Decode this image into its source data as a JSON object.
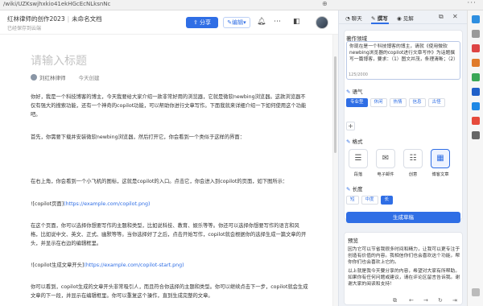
{
  "browser": {
    "url": "/wiki/UZKswjhxkio41ekHGcEcNLksnNc",
    "zoom_icon": "zoom-icon",
    "menu_icon": "more-dots-icon"
  },
  "header": {
    "breadcrumb_space": "红林律师的创作2023",
    "breadcrumb_doc": "未命名文档",
    "saved_status": "已经保存到云端",
    "share_label": "分享",
    "edit_label": "编辑",
    "share_icon": "share-icon",
    "edit_icon": "pencil-icon",
    "icons": [
      "bell-icon",
      "more-icon",
      "avatar"
    ]
  },
  "document": {
    "title_placeholder": "请输入标题",
    "author": "刘红林律师",
    "created": "今天创建",
    "paragraphs": [
      "你好，我是一个科技博客的博主，今天我要给大家介绍一款非常好用的浏览器，它就是微软newbing浏览器。这款浏览器不仅有强大的搜索功能，还有一个神奇的copilot功能，可以帮助你进行文章写作。下面我就来详细介绍一下如何使用这个功能吧。",
      "首先，你需要下载并安装微软newbing浏览器，然后打开它，你会看到一个类似于这样的界面：",
      "在右上角，你会看到一个小飞机的图标，这就是copilot的入口。点击它，你会进入到copilot的页面，如下图所示：",
      "在这个页面，你可以选择你想要写作的主题和类型，比如说科技、教育、娱乐等等。你还可以选择你想要写作的语言和风格，比如说中文、英文、正式、幽默等等。当你选择好了之后，点击开始写作，copilot就会根据你的选择生成一篇文章的开头，并显示在右边的编辑框里。",
      "你可以看到，copilot生成的文章开头非常吸引人，而且符合你选择的主题和类型。你可以继续点击下一步，copilot就会生成文章的下一段，并显示在编辑框里。你可以重复这个操作，直到生成完整的文章。"
    ],
    "link1_text": "![copilot页面]",
    "link1_url": "(https://example.com/copilot.png)",
    "link2_text": "![copilot生成文章开头]",
    "link2_url": "(https://example.com/copilot-start.png)"
  },
  "panel": {
    "tabs": [
      {
        "label": "聊天",
        "icon": "chat-icon"
      },
      {
        "label": "撰写",
        "icon": "compose-icon"
      },
      {
        "label": "见解",
        "icon": "insights-icon"
      }
    ],
    "active_tab": "撰写",
    "topic_label": "著作领域",
    "prompt_text": "你现在是一个科技博客的博主，请就《使用微软newbing浏览器的copilot进行文章写作》为话题撰写一篇博客，要求：（1）图文并茂，条理清晰；（2）",
    "counter": "125/2000",
    "tone_label": "语气",
    "tones": [
      {
        "label": "专业型",
        "selected": true
      },
      {
        "label": "休闲",
        "selected": false
      },
      {
        "label": "热情",
        "selected": false
      },
      {
        "label": "信息",
        "selected": false
      },
      {
        "label": "古怪",
        "selected": false
      }
    ],
    "add_tone_icon": "plus-icon",
    "format_label": "格式",
    "formats": [
      {
        "label": "段落",
        "icon": "paragraph-icon",
        "glyph": "☰",
        "selected": false
      },
      {
        "label": "电子邮件",
        "icon": "mail-icon",
        "glyph": "✉",
        "selected": false
      },
      {
        "label": "创意",
        "icon": "ideas-icon",
        "glyph": "☷",
        "selected": false
      },
      {
        "label": "博客文章",
        "icon": "blog-icon",
        "glyph": "▦",
        "selected": true
      }
    ],
    "length_label": "长度",
    "lengths": [
      {
        "label": "短",
        "selected": false
      },
      {
        "label": "中度",
        "selected": false
      },
      {
        "label": "长",
        "selected": true
      }
    ],
    "generate_label": "生成草稿",
    "preview_label": "预览",
    "preview_p1": "因为它可以节省我很多时间和精力，让我可以更专注于创造有价值的内容。我相信你们也会喜欢这个功能，帮你你们也会喜欢上它的。",
    "preview_p2": "以上就是我今天要分享的内容，希望对大家有所帮助。如果你有任何问题或建议，请在评论区留言告诉我。谢谢大家的阅读和支持！"
  },
  "colors": {
    "accent": "#2f6ee5",
    "panel_bg": "#eef1f6"
  }
}
